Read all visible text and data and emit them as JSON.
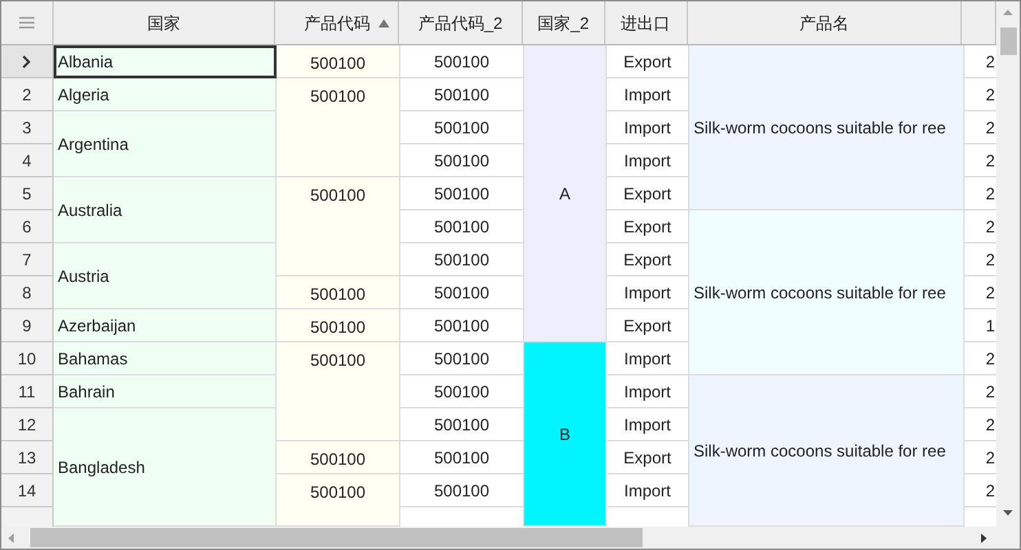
{
  "columns": [
    {
      "label": "国家",
      "sorted": false
    },
    {
      "label": "产品代码",
      "sorted": true
    },
    {
      "label": "产品代码_2",
      "sorted": false
    },
    {
      "label": "国家_2",
      "sorted": false
    },
    {
      "label": "进出口",
      "sorted": false
    },
    {
      "label": "产品名",
      "sorted": false
    },
    {
      "sorted": false
    }
  ],
  "rows": [
    {
      "current": true,
      "cells": [
        "Albania",
        "500100",
        "500100",
        {
          "text": "A",
          "color": "#eeeefc"
        },
        "Export",
        "Silk-worm cocoons suitable for ree",
        "2"
      ]
    },
    {
      "header": "2",
      "current": false,
      "cells": [
        "Algeria",
        "500100",
        "500100",
        null,
        "Import",
        null,
        "2"
      ]
    },
    {
      "header": "3",
      "current": false,
      "cells": [
        "Argentina",
        null,
        "500100",
        null,
        "Import",
        null,
        "2"
      ]
    },
    {
      "header": "4",
      "current": false,
      "cells": [
        null,
        null,
        "500100",
        null,
        "Import",
        null,
        "2"
      ]
    },
    {
      "header": "5",
      "current": false,
      "cells": [
        "Australia",
        "500100",
        "500100",
        null,
        "Export",
        null,
        "2"
      ]
    },
    {
      "header": "6",
      "current": false,
      "cells": [
        null,
        null,
        "500100",
        null,
        "Export",
        "Silk-worm cocoons suitable for ree",
        "2"
      ]
    },
    {
      "header": "7",
      "current": false,
      "cells": [
        "Austria",
        null,
        "500100",
        null,
        "Export",
        null,
        "2"
      ]
    },
    {
      "header": "8",
      "current": false,
      "cells": [
        null,
        "500100",
        "500100",
        null,
        "Import",
        null,
        "2"
      ]
    },
    {
      "header": "9",
      "current": false,
      "cells": [
        "Azerbaijan",
        "500100",
        "500100",
        null,
        "Export",
        null,
        "1"
      ]
    },
    {
      "header": "10",
      "current": false,
      "cells": [
        "Bahamas",
        "500100",
        "500100",
        {
          "text": "B",
          "color": "#00f5ff"
        },
        "Import",
        null,
        "2"
      ]
    },
    {
      "header": "11",
      "current": false,
      "cells": [
        "Bahrain",
        null,
        "500100",
        null,
        "Import",
        "Silk-worm cocoons suitable for ree",
        "2"
      ]
    },
    {
      "header": "12",
      "current": false,
      "cells": [
        "Bangladesh",
        null,
        "500100",
        null,
        "Import",
        null,
        "2"
      ]
    },
    {
      "header": "13",
      "current": false,
      "cells": [
        null,
        "500100",
        "500100",
        null,
        "Export",
        null,
        "2"
      ]
    },
    {
      "header": "14",
      "current": false,
      "cells": [
        null,
        "500100",
        "500100",
        null,
        "Import",
        null,
        "2"
      ]
    }
  ]
}
